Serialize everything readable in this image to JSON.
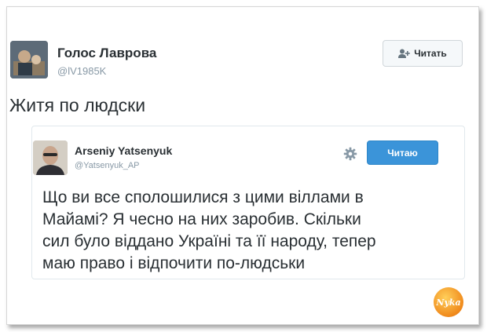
{
  "tweet": {
    "author_name": "Голос Лаврова",
    "author_handle": "@lV1985K",
    "follow_label": "Читать",
    "text": "Житя по людски"
  },
  "quoted": {
    "author_name": "Arseniy Yatsenyuk",
    "author_handle": "@Yatsenyuk_AP",
    "follow_label": "Читаю",
    "text_lines": [
      "Що ви все сполошилися з цими віллами в",
      "Майамі? Я чесно на них заробив. Скільки",
      "сил було віддано Україні та її народу, тепер",
      "маю право і відпочити по-людськи"
    ]
  },
  "watermark": {
    "text": "Nyka"
  },
  "icons": {
    "follow": "add-user-icon",
    "settings": "gear-icon"
  },
  "colors": {
    "accent": "#3b94d9",
    "text": "#292f33",
    "muted": "#8899a6"
  }
}
